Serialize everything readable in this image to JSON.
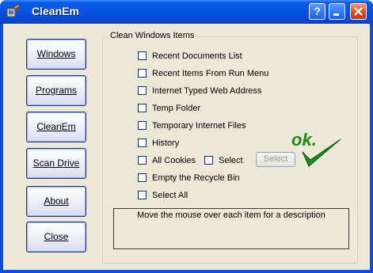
{
  "window": {
    "title": "CleanEm"
  },
  "titlebar": {
    "help_label": "?",
    "minimize_label": "_",
    "close_label": "×"
  },
  "nav": [
    {
      "label": "Windows"
    },
    {
      "label": "Programs"
    },
    {
      "label": "CleanEm"
    },
    {
      "label": "Scan Drive"
    },
    {
      "label": "About"
    },
    {
      "label": "Close"
    }
  ],
  "group": {
    "title": "Clean Windows Items"
  },
  "items": [
    {
      "label": "Recent Documents List",
      "checked": false
    },
    {
      "label": "Recent Items From Run Menu",
      "checked": false
    },
    {
      "label": "Internet Typed Web Address",
      "checked": false
    },
    {
      "label": "Temp Folder",
      "checked": false
    },
    {
      "label": "Temporary Internet Files",
      "checked": false
    },
    {
      "label": "History",
      "checked": false
    },
    {
      "label": "All Cookies",
      "checked": false
    },
    {
      "label": "Empty the Recycle Bin",
      "checked": false
    },
    {
      "label": "Select All",
      "checked": false
    }
  ],
  "cookies_select": {
    "checkbox_label": "Select",
    "button_label": "Select",
    "button_enabled": false
  },
  "description": {
    "text": "Move the mouse over each item for a description"
  },
  "ok_logo": {
    "text": "ok."
  },
  "colors": {
    "titlebar": "#0651e0",
    "client": "#ece9d8",
    "ok_green": "#1a8a1a"
  }
}
